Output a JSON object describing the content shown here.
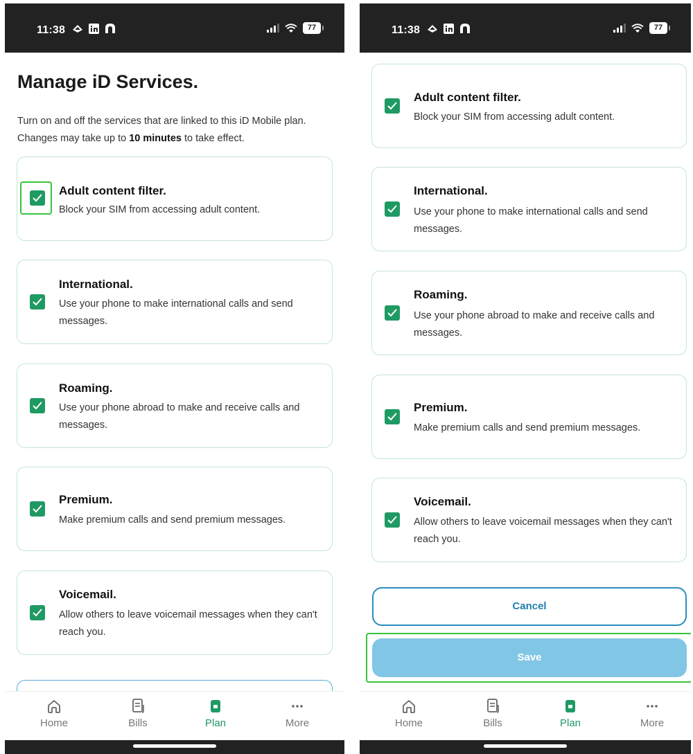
{
  "status_bar": {
    "time": "11:38",
    "battery": "77"
  },
  "page": {
    "title": "Manage iD Services.",
    "intro_before": "Turn on and off the services that are linked to this iD Mobile plan. Changes may take up to ",
    "intro_bold": "10 minutes",
    "intro_after": " to take effect."
  },
  "services": [
    {
      "title": "Adult content filter.",
      "description": "Block your SIM from accessing adult content.",
      "checked": true
    },
    {
      "title": "International.",
      "description": "Use your phone to make international calls and send messages.",
      "checked": true
    },
    {
      "title": "Roaming.",
      "description": "Use your phone abroad to make and receive calls and messages.",
      "checked": true
    },
    {
      "title": "Premium.",
      "description": "Make premium calls and send premium messages.",
      "checked": true
    },
    {
      "title": "Voicemail.",
      "description": "Allow others to leave voicemail messages when they can't reach you.",
      "checked": true
    }
  ],
  "actions": {
    "cancel": "Cancel",
    "save": "Save"
  },
  "tabbar": [
    {
      "label": "Home",
      "icon": "home-icon"
    },
    {
      "label": "Bills",
      "icon": "bills-icon"
    },
    {
      "label": "Plan",
      "icon": "plan-icon",
      "active": true
    },
    {
      "label": "More",
      "icon": "more-icon"
    }
  ],
  "colors": {
    "accent_green": "#1f9a63",
    "button_blue": "#2a8cc0",
    "save_disabled": "#82c6e6",
    "highlight": "#35c43c"
  }
}
